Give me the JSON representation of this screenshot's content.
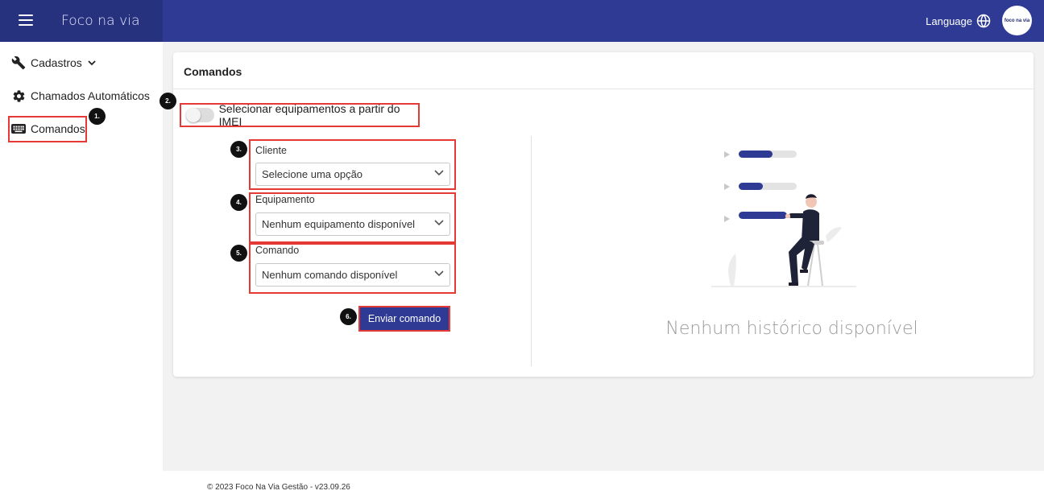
{
  "header": {
    "brand": "Foco na via",
    "language_label": "Language",
    "avatar_text": "foco na via"
  },
  "sidebar": {
    "items": [
      {
        "label": "Cadastros",
        "icon": "wrench-icon"
      },
      {
        "label": "Chamados Automáticos",
        "icon": "gear-icon"
      },
      {
        "label": "Comandos",
        "icon": "keyboard-icon"
      }
    ]
  },
  "main": {
    "card_title": "Comandos",
    "imei_toggle_label": "Selecionar equipamentos a partir do IMEI",
    "fields": [
      {
        "label": "Cliente",
        "value": "Selecione uma opção"
      },
      {
        "label": "Equipamento",
        "value": "Nenhum equipamento disponível"
      },
      {
        "label": "Comando",
        "value": "Nenhum comando disponível"
      }
    ],
    "send_button": "Enviar comando",
    "empty_history": "Nenhum histórico disponível"
  },
  "annotations": [
    "1.",
    "2.",
    "3.",
    "4.",
    "5.",
    "6."
  ],
  "footer": {
    "text": "© 2023 Foco Na Via Gestão - v23.09.26"
  },
  "colors": {
    "primary": "#2e3a94",
    "annotation_border": "#e53935"
  }
}
